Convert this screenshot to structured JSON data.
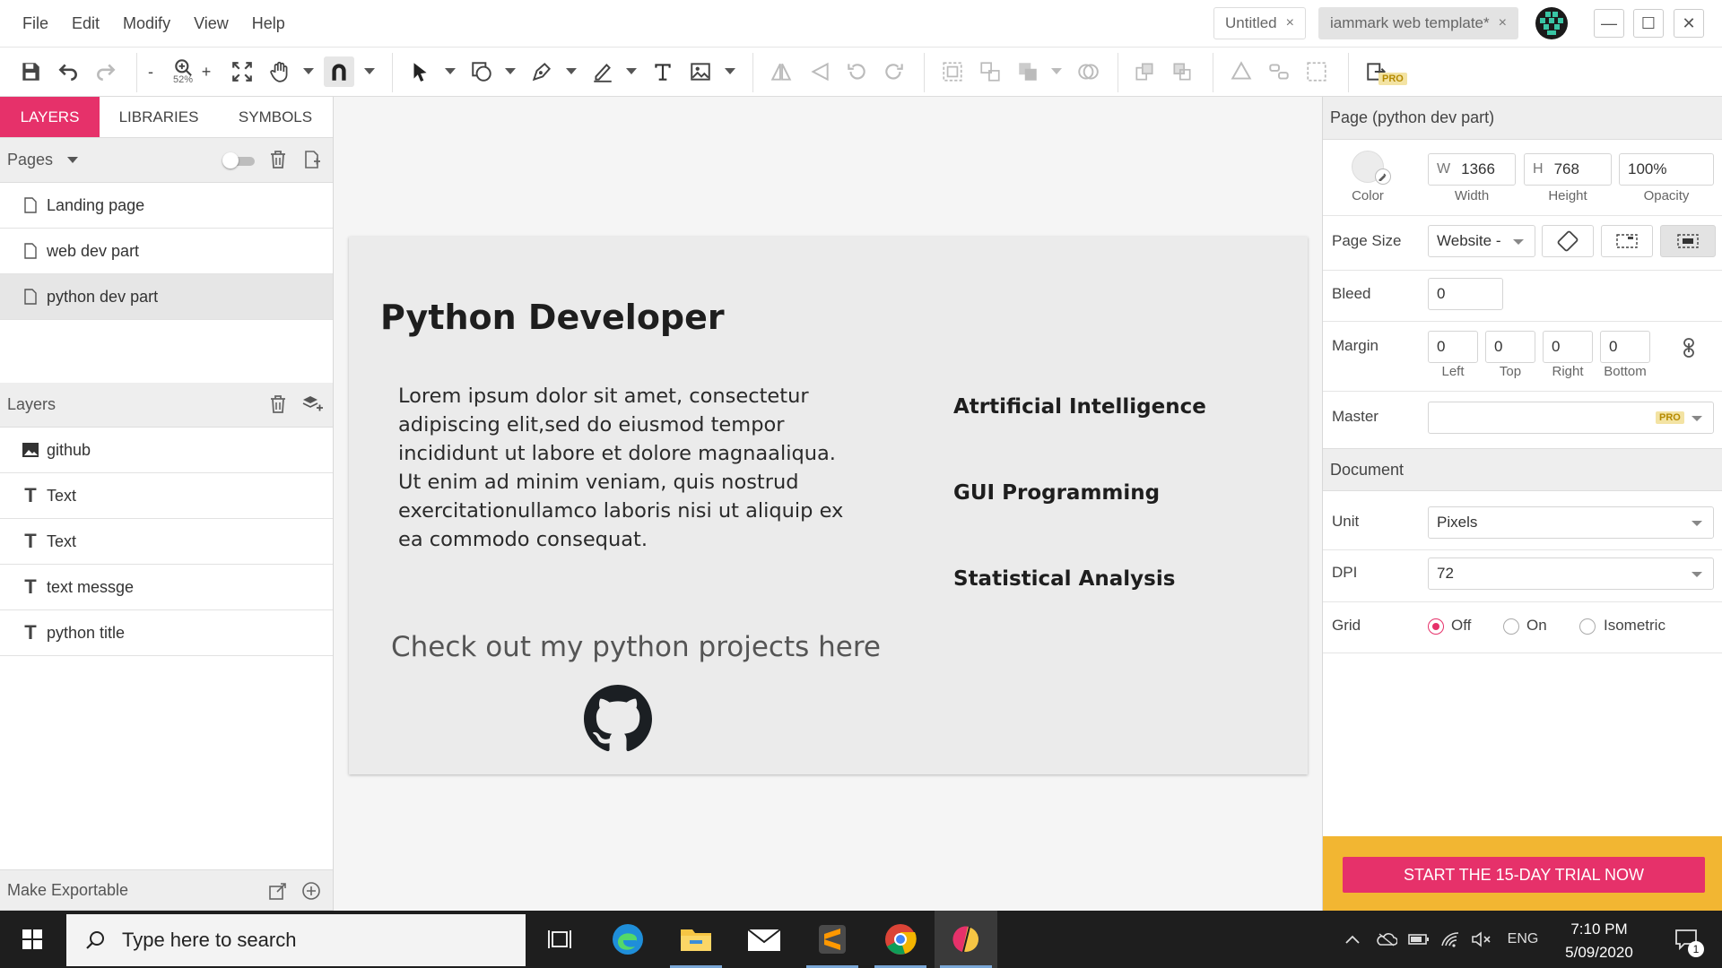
{
  "menu": [
    "File",
    "Edit",
    "Modify",
    "View",
    "Help"
  ],
  "doc_tabs": [
    {
      "label": "Untitled",
      "close": "×"
    },
    {
      "label": "iammark web template*",
      "close": "×"
    }
  ],
  "window_controls": {
    "minimize": "—",
    "maximize": "☐",
    "close": "✕"
  },
  "toolbar": {
    "zoom_minus": "-",
    "zoom_plus": "+",
    "zoom_value": "52%"
  },
  "left_panel": {
    "tabs": [
      "LAYERS",
      "LIBRARIES",
      "SYMBOLS"
    ],
    "pages_label": "Pages",
    "pages": [
      "Landing page",
      "web dev part",
      "python dev part"
    ],
    "selected_page_index": 2,
    "layers_label": "Layers",
    "layers": [
      {
        "icon": "image-icon",
        "label": "github"
      },
      {
        "icon": "text-icon",
        "label": "Text"
      },
      {
        "icon": "text-icon",
        "label": "Text"
      },
      {
        "icon": "text-icon",
        "label": "text messge"
      },
      {
        "icon": "text-icon",
        "label": "python title"
      }
    ],
    "text_glyph": "T",
    "make_exportable": "Make Exportable"
  },
  "artboard": {
    "title": "Python Developer",
    "body": "Lorem ipsum dolor sit amet, consectetur adipiscing elit,sed do eiusmod tempor incididunt ut labore et dolore magnaaliqua. Ut enim ad minim veniam, quis nostrud exercitationullamco laboris nisi ut aliquip ex ea commodo consequat.",
    "skills": [
      "Atrtificial Intelligence",
      "GUI Programming",
      "Statistical Analysis"
    ],
    "message": "Check out my python projects here"
  },
  "right_panel": {
    "page_header": "Page (python dev part)",
    "color_label": "Color",
    "width_prefix": "W",
    "width": "1366",
    "width_label": "Width",
    "height_prefix": "H",
    "height": "768",
    "height_label": "Height",
    "opacity": "100%",
    "opacity_label": "Opacity",
    "page_size_label": "Page Size",
    "page_size": "Website -",
    "bleed_label": "Bleed",
    "bleed": "0",
    "margin_label": "Margin",
    "margins": [
      {
        "value": "0",
        "label": "Left"
      },
      {
        "value": "0",
        "label": "Top"
      },
      {
        "value": "0",
        "label": "Right"
      },
      {
        "value": "0",
        "label": "Bottom"
      }
    ],
    "master_label": "Master",
    "master_value": "",
    "pro_badge": "PRO",
    "document_header": "Document",
    "unit_label": "Unit",
    "unit": "Pixels",
    "dpi_label": "DPI",
    "dpi": "72",
    "grid_label": "Grid",
    "grid_options": [
      "Off",
      "On",
      "Isometric"
    ],
    "grid_selected": "Off",
    "trial_button": "START THE 15-DAY TRIAL NOW",
    "accent": "#e6316a",
    "trial_bg": "#f2b632"
  },
  "taskbar": {
    "search_placeholder": "Type here to search",
    "language": "ENG",
    "time": "7:10 PM",
    "date": "5/09/2020",
    "notification_count": "1"
  }
}
